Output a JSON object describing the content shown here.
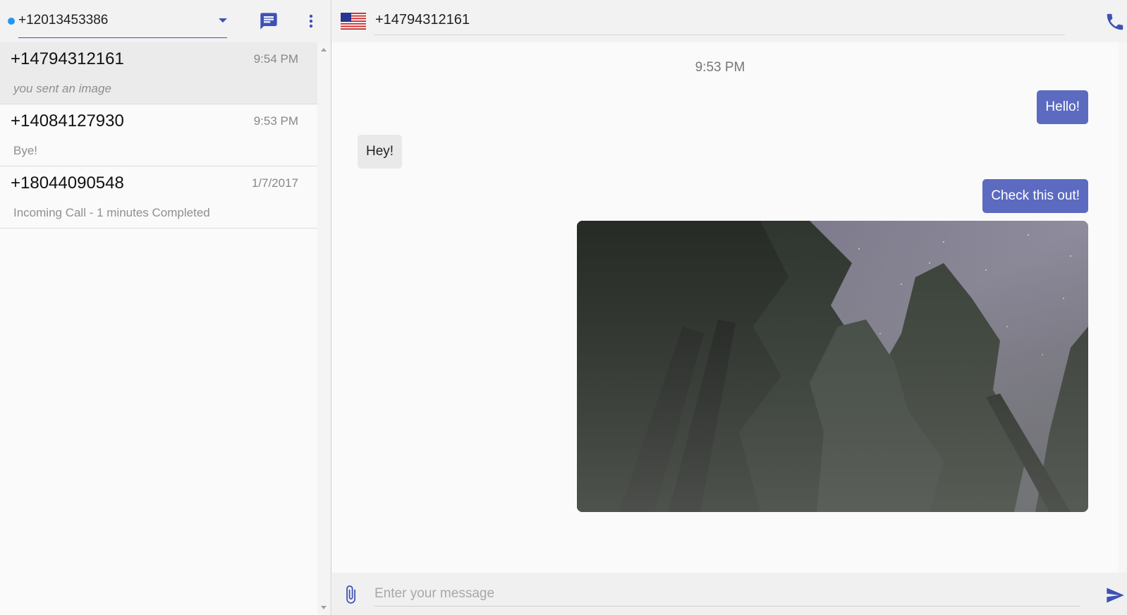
{
  "app": {
    "colors": {
      "accent": "#3f51b5",
      "bubble_out": "#5c6bc0",
      "bubble_in": "#e9e9e9",
      "status_online": "#2196f3"
    }
  },
  "sidebar": {
    "line_number": "+12013453386",
    "icons": {
      "line_status": "status-dot",
      "new_message": "new-message-icon",
      "menu": "more-vert-icon"
    },
    "conversations": [
      {
        "number": "+14794312161",
        "time": "9:54 PM",
        "preview": "you sent an image",
        "active": true
      },
      {
        "number": "+14084127930",
        "time": "9:53 PM",
        "preview": "Bye!",
        "active": false
      },
      {
        "number": "+18044090548",
        "time": "1/7/2017",
        "preview": "Incoming Call - 1 minutes Completed",
        "active": false
      }
    ]
  },
  "chat": {
    "flag": "us-flag-icon",
    "contact_number": "+14794312161",
    "date_label": "9:53 PM",
    "messages": [
      {
        "direction": "out",
        "text": "Hello!"
      },
      {
        "direction": "in",
        "text": "Hey!"
      },
      {
        "direction": "out",
        "text": "Check this out!"
      },
      {
        "direction": "out",
        "type": "image",
        "image": "night-forest-photo"
      }
    ],
    "compose": {
      "placeholder": "Enter your message",
      "value": ""
    }
  }
}
